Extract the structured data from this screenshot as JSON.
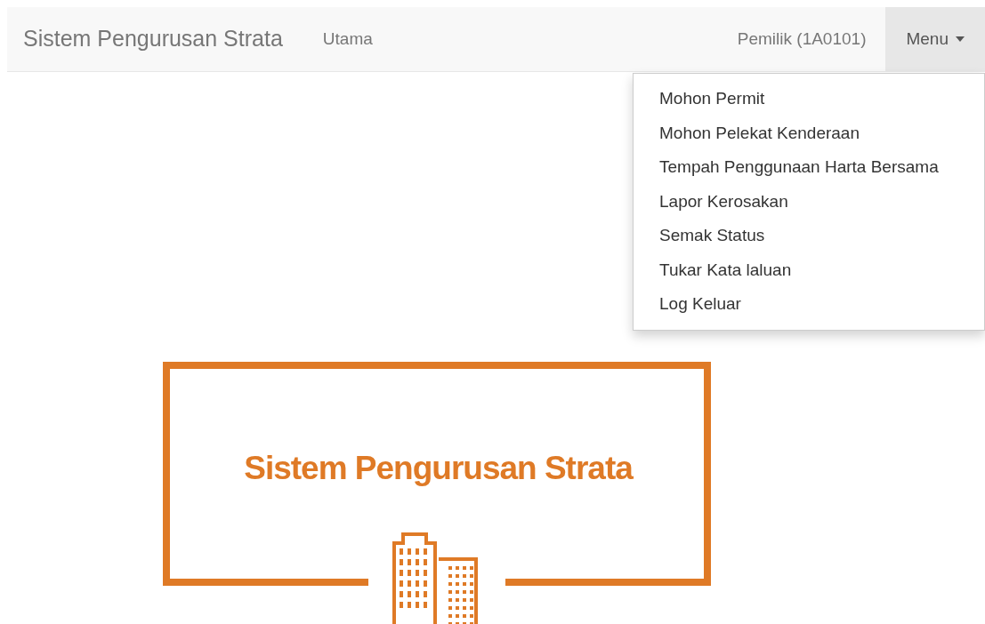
{
  "navbar": {
    "brand": "Sistem Pengurusan Strata",
    "links": [
      {
        "label": "Utama"
      }
    ],
    "user": "Pemilik (1A0101)",
    "menu": {
      "label": "Menu",
      "expanded": true,
      "items": [
        "Mohon Permit",
        "Mohon Pelekat Kenderaan",
        "Tempah Penggunaan Harta Bersama",
        "Lapor Kerosakan",
        "Semak Status",
        "Tukar Kata laluan",
        "Log Keluar"
      ]
    }
  },
  "logo": {
    "title": "Sistem Pengurusan Strata"
  }
}
